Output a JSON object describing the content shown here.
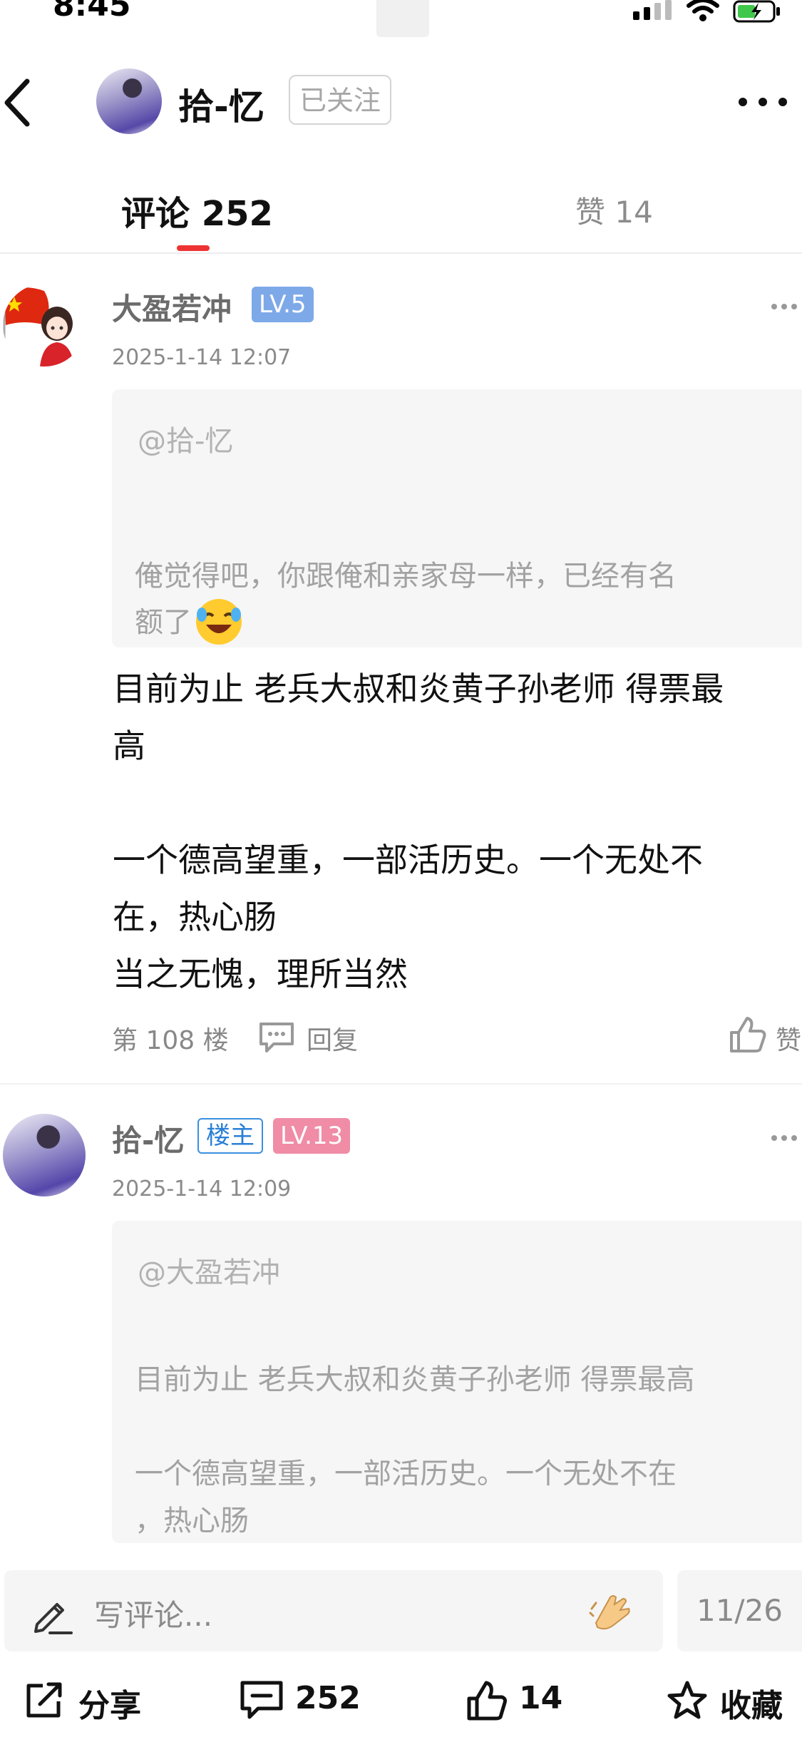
{
  "status_bar": {
    "time": "8:45"
  },
  "header": {
    "title": "拾-忆",
    "follow_label": "已关注"
  },
  "tabs": {
    "comments": "评论 252",
    "likes": "赞 14"
  },
  "comments": [
    {
      "username": "大盈若冲",
      "level": "LV.5",
      "time": "2025-1-14 12:07",
      "quote_at": "@拾-忆",
      "quote_text": "俺觉得吧，你跟俺和亲家母一样，已经有名\n额了",
      "quote_emoji": "laughing-crying-emoji",
      "text": "目前为止 老兵大叔和炎黄子孙老师 得票最\n高\n\n一个德高望重，一部活历史。一个无处不\n在，热心肠\n当之无愧，理所当然",
      "floor": "第 108 楼",
      "reply_label": "回复",
      "like_label": "赞"
    },
    {
      "username": "拾-忆",
      "owner_badge": "楼主",
      "level": "LV.13",
      "time": "2025-1-14 12:09",
      "quote_at": "@大盈若冲",
      "quote_text": "目前为止 老兵大叔和炎黄子孙老师 得票最高\n\n一个德高望重，一部活历史。一个无处不在\n，热心肠"
    }
  ],
  "input": {
    "placeholder": "写评论...",
    "page_indicator": "11/26"
  },
  "bottom_bar": {
    "share": "分享",
    "comments": "252",
    "likes": "14",
    "favorite": "收藏"
  },
  "colors": {
    "accent_red": "#e33333",
    "level_blue": "#7ea9e8",
    "level_pink": "#f08ca6",
    "owner_blue": "#2a7fd6"
  }
}
